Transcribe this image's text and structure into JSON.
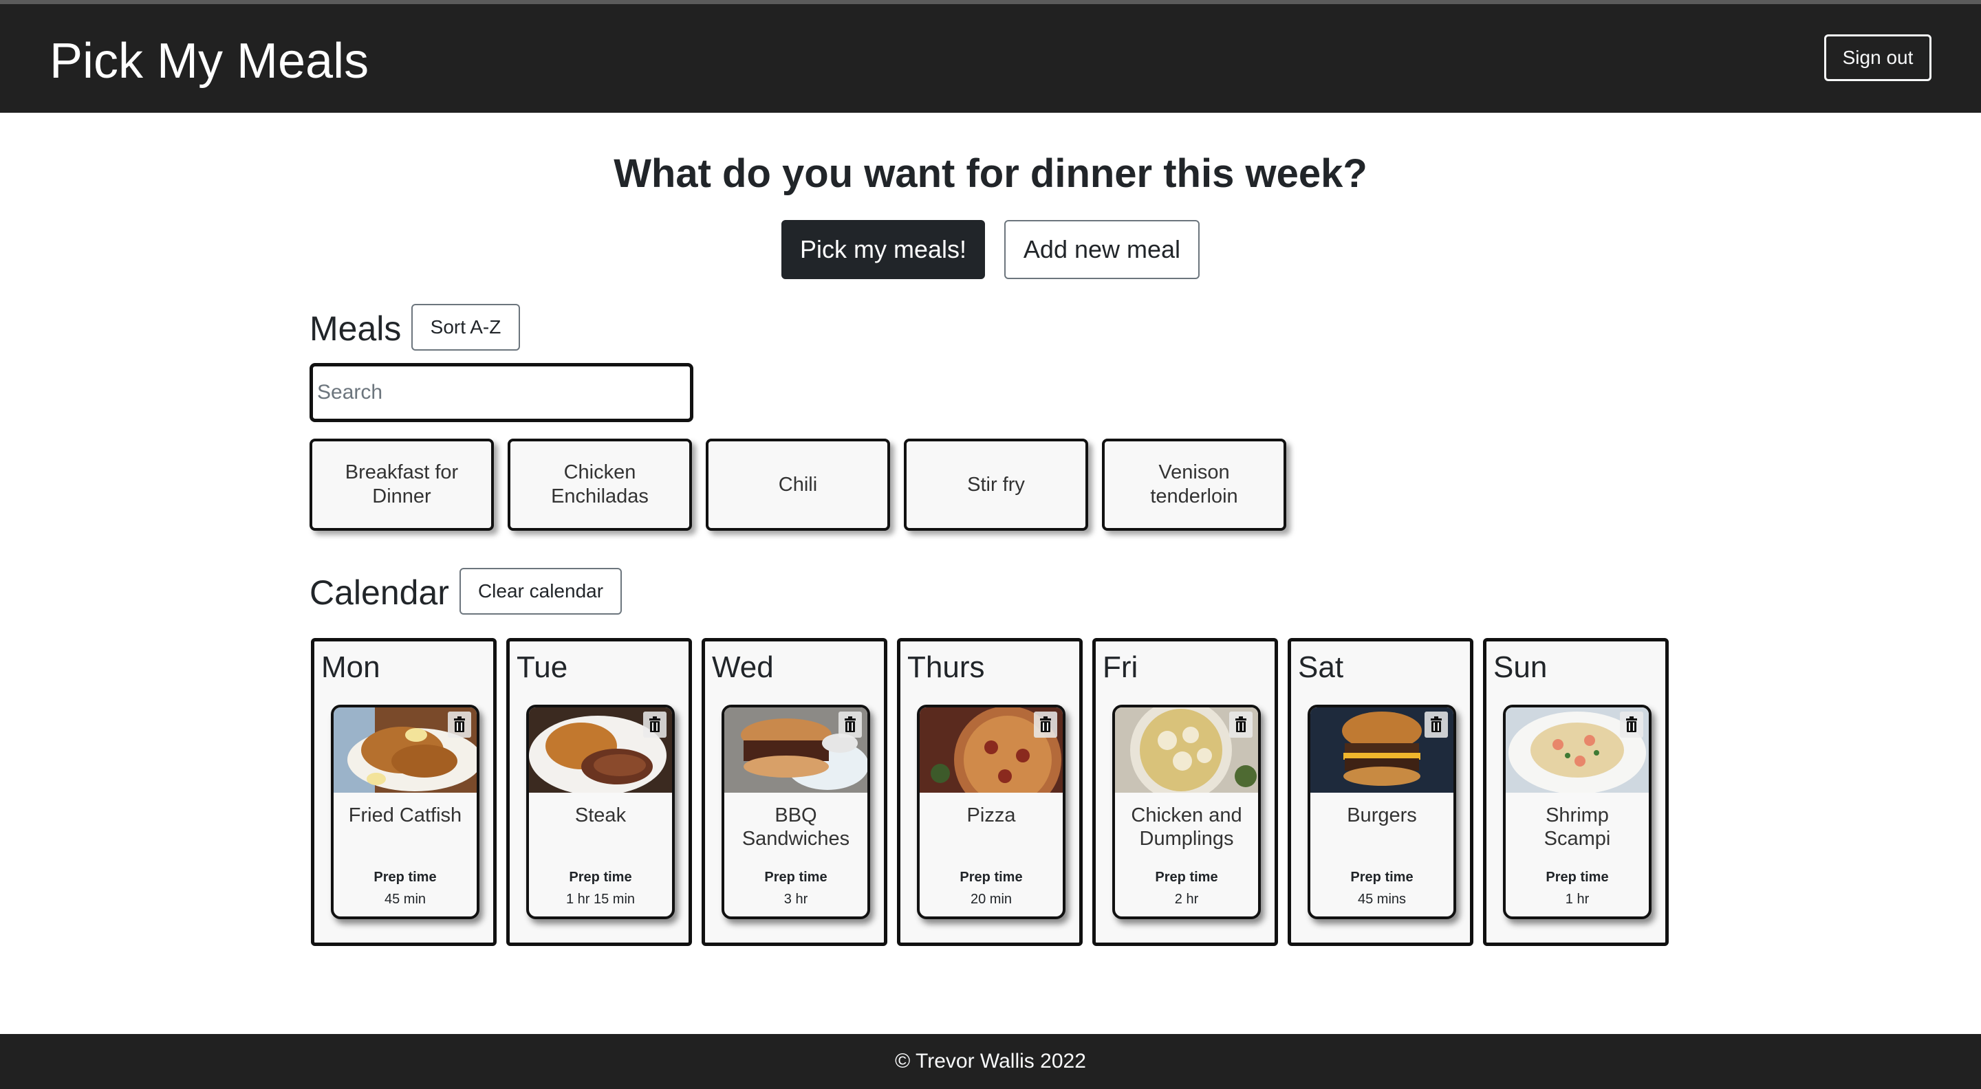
{
  "navbar": {
    "brand": "Pick My Meals",
    "signout_label": "Sign out"
  },
  "hero": {
    "headline": "What do you want for dinner this week?",
    "pick_label": "Pick my meals!",
    "add_label": "Add new meal"
  },
  "meals": {
    "title": "Meals",
    "sort_label": "Sort A-Z",
    "search_placeholder": "Search",
    "search_value": "",
    "items": [
      {
        "label": "Breakfast for Dinner"
      },
      {
        "label": "Chicken Enchiladas"
      },
      {
        "label": "Chili"
      },
      {
        "label": "Stir fry"
      },
      {
        "label": "Venison tenderloin"
      }
    ]
  },
  "calendar": {
    "title": "Calendar",
    "clear_label": "Clear calendar",
    "prep_label": "Prep time",
    "days": [
      {
        "day": "Mon",
        "meal": "Fried Catfish",
        "prep": "45 min",
        "icon": "trash-icon"
      },
      {
        "day": "Tue",
        "meal": "Steak",
        "prep": "1 hr 15 min",
        "icon": "trash-icon"
      },
      {
        "day": "Wed",
        "meal": "BBQ Sandwiches",
        "prep": "3 hr",
        "icon": "trash-icon"
      },
      {
        "day": "Thurs",
        "meal": "Pizza",
        "prep": "20 min",
        "icon": "trash-icon"
      },
      {
        "day": "Fri",
        "meal": "Chicken and Dumplings",
        "prep": "2 hr",
        "icon": "trash-icon"
      },
      {
        "day": "Sat",
        "meal": "Burgers",
        "prep": "45 mins",
        "icon": "trash-icon"
      },
      {
        "day": "Sun",
        "meal": "Shrimp Scampi",
        "prep": "1 hr",
        "icon": "trash-icon"
      }
    ]
  },
  "footer": {
    "text": "© Trevor Wallis 2022"
  },
  "colors": {
    "navbar": "#212121",
    "card_bg": "#f8f8f8",
    "border": "#111111",
    "primary_btn": "#212529"
  }
}
